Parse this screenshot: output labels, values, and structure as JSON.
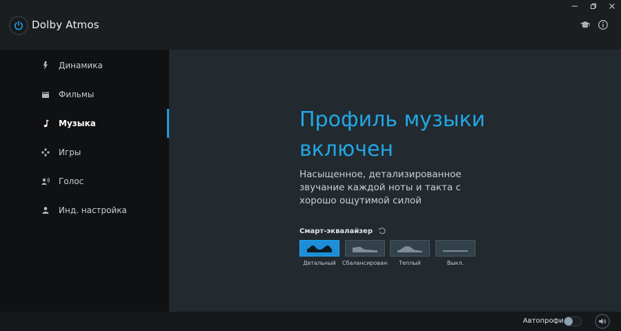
{
  "app": {
    "title": "Dolby Atmos"
  },
  "window_controls": [
    "minimize-icon",
    "restore-icon",
    "close-icon"
  ],
  "header_icons": [
    "graduation-cap-icon",
    "info-icon"
  ],
  "sidebar": {
    "items": [
      {
        "label": "Динамика",
        "icon": "lightning-icon"
      },
      {
        "label": "Фильмы",
        "icon": "film-clapper-icon"
      },
      {
        "label": "Музыка",
        "icon": "music-note-icon",
        "active": true
      },
      {
        "label": "Игры",
        "icon": "gamepad-icon"
      },
      {
        "label": "Голос",
        "icon": "voice-icon"
      },
      {
        "label": "Инд. настройка",
        "icon": "person-icon"
      }
    ]
  },
  "main": {
    "headline": "Профиль музыки включен",
    "description": "Насыщенное, детализированное звучание каждой ноты и такта с хорошо ощутимой силой",
    "equalizer": {
      "title": "Смарт-эквалайзер",
      "reset_icon": "reset-icon",
      "presets": [
        {
          "label": "Детальный",
          "selected": true
        },
        {
          "label": "Сбалансированн",
          "selected": false
        },
        {
          "label": "Теплый",
          "selected": false
        },
        {
          "label": "Выкл.",
          "selected": false
        }
      ]
    }
  },
  "footer": {
    "autoprofile_label": "Автопрофиль",
    "autoprofile_on": false
  },
  "colors": {
    "accent": "#1ea0e0",
    "sidebar_bg": "#0f1113",
    "main_bg": "#222a2f"
  }
}
